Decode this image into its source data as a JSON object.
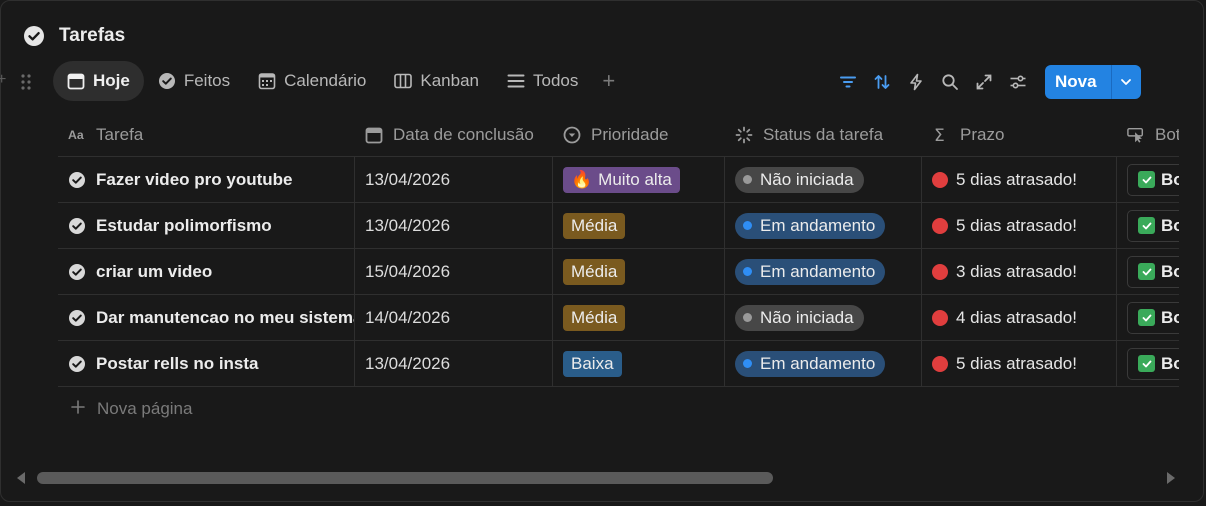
{
  "page": {
    "title": "Tarefas"
  },
  "tabs": [
    {
      "label": "Hoje",
      "icon": "calendar-icon",
      "active": true
    },
    {
      "label": "Feitos",
      "icon": "check-circle-icon",
      "active": false
    },
    {
      "label": "Calendário",
      "icon": "calendar-grid-icon",
      "active": false
    },
    {
      "label": "Kanban",
      "icon": "kanban-icon",
      "active": false
    },
    {
      "label": "Todos",
      "icon": "list-icon",
      "active": false
    }
  ],
  "toolbar": {
    "new_label": "Nova",
    "accent": "#2383e2"
  },
  "columns": [
    {
      "label": "Tarefa",
      "icon": "text-property-icon"
    },
    {
      "label": "Data de conclusão",
      "icon": "calendar-icon"
    },
    {
      "label": "Prioridade",
      "icon": "select-icon"
    },
    {
      "label": "Status da tarefa",
      "icon": "status-icon"
    },
    {
      "label": "Prazo",
      "icon": "formula-sigma-icon"
    },
    {
      "label": "Botã",
      "icon": "pointer-icon"
    }
  ],
  "rows": [
    {
      "task": "Fazer video pro youtube",
      "date": "13/04/2026",
      "priority": "Muito alta",
      "priority_emoji": "🔥",
      "status": "Não iniciada",
      "deadline": "5 dias atrasado!",
      "button": "Bot"
    },
    {
      "task": "Estudar polimorfismo",
      "date": "13/04/2026",
      "priority": "Média",
      "priority_emoji": "",
      "status": "Em andamento",
      "deadline": "5 dias atrasado!",
      "button": "Bot"
    },
    {
      "task": "criar um video",
      "date": "15/04/2026",
      "priority": "Média",
      "priority_emoji": "",
      "status": "Em andamento",
      "deadline": "3 dias atrasado!",
      "button": "Bot"
    },
    {
      "task": "Dar manutencao no meu sistema",
      "date": "14/04/2026",
      "priority": "Média",
      "priority_emoji": "",
      "status": "Não iniciada",
      "deadline": "4 dias atrasado!",
      "button": "Bot"
    },
    {
      "task": "Postar rells no insta",
      "date": "13/04/2026",
      "priority": "Baixa",
      "priority_emoji": "",
      "status": "Em andamento",
      "deadline": "5 dias atrasado!",
      "button": "Bot"
    }
  ],
  "footer": {
    "new_page_label": "Nova página"
  }
}
